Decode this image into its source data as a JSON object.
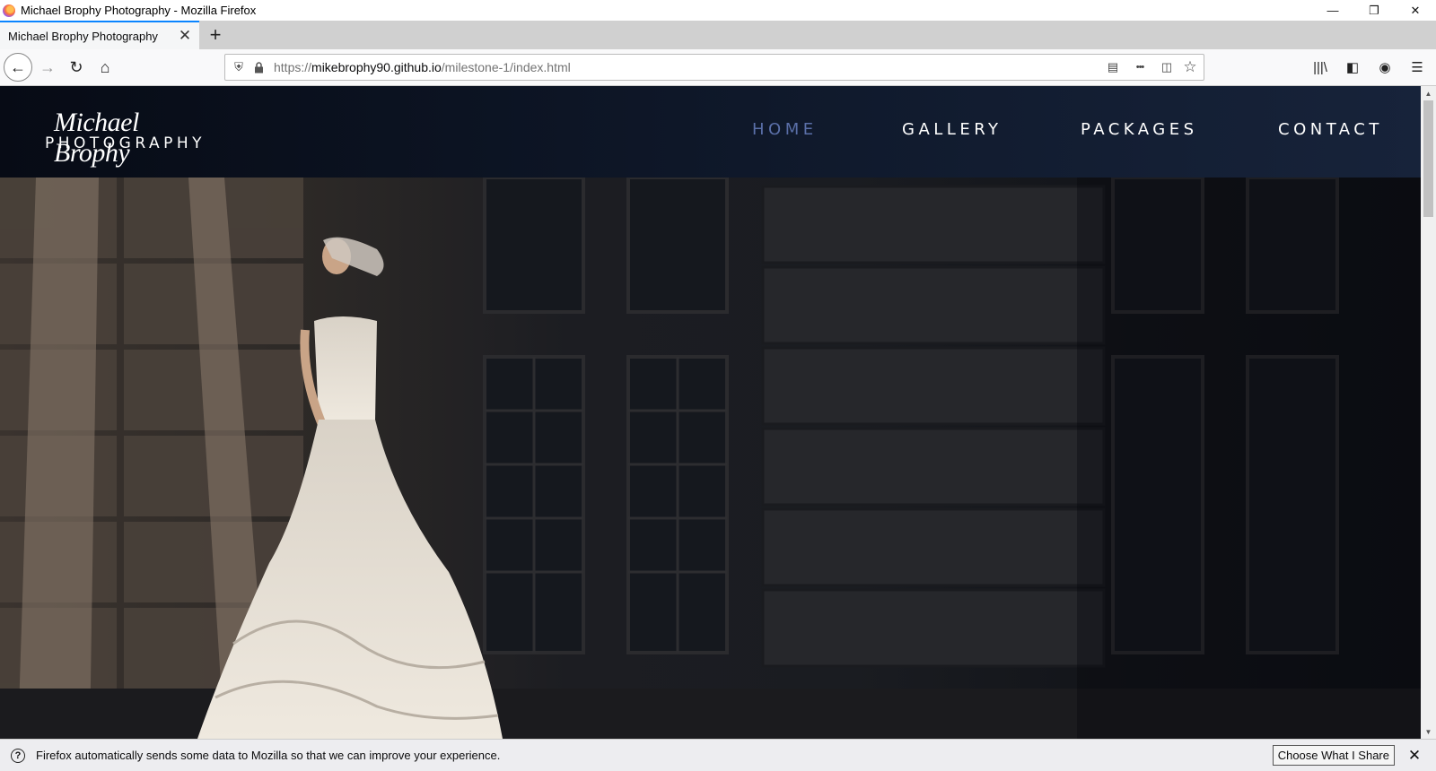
{
  "window": {
    "title": "Michael Brophy Photography - Mozilla Firefox",
    "minimize": "—",
    "restore": "❐",
    "close": "✕"
  },
  "tabs": [
    {
      "label": "Michael Brophy Photography",
      "close": "✕"
    }
  ],
  "newtab_label": "+",
  "navbar": {
    "back": "←",
    "forward": "→",
    "reload": "↻",
    "home": "⌂",
    "url_prefix": "https://",
    "url_domain": "mikebrophy90.github.io",
    "url_path": "/milestone-1/index.html",
    "shield": "⛨",
    "lock": "🔒",
    "reader": "▤",
    "more": "•••",
    "pocket": "◫",
    "bookmark": "☆",
    "library": "|||\\",
    "sidebar": "◧",
    "account": "◉",
    "menu": "☰"
  },
  "site": {
    "brand_script": "Michael Brophy",
    "brand_caps": "PHOTOGRAPHY",
    "nav": [
      {
        "label": "HOME",
        "active": true
      },
      {
        "label": "GALLERY",
        "active": false
      },
      {
        "label": "PACKAGES",
        "active": false
      },
      {
        "label": "CONTACT",
        "active": false
      }
    ],
    "nav_active_color": "#5a6fa8"
  },
  "notification": {
    "message": "Firefox automatically sends some data to Mozilla so that we can improve your experience.",
    "button": "Choose What I Share",
    "icon": "?",
    "close": "✕"
  },
  "scrollbar": {
    "up": "▲",
    "down": "▼"
  },
  "colors": {
    "accent": "#0a84ff",
    "header_bg": "#0b1222"
  }
}
